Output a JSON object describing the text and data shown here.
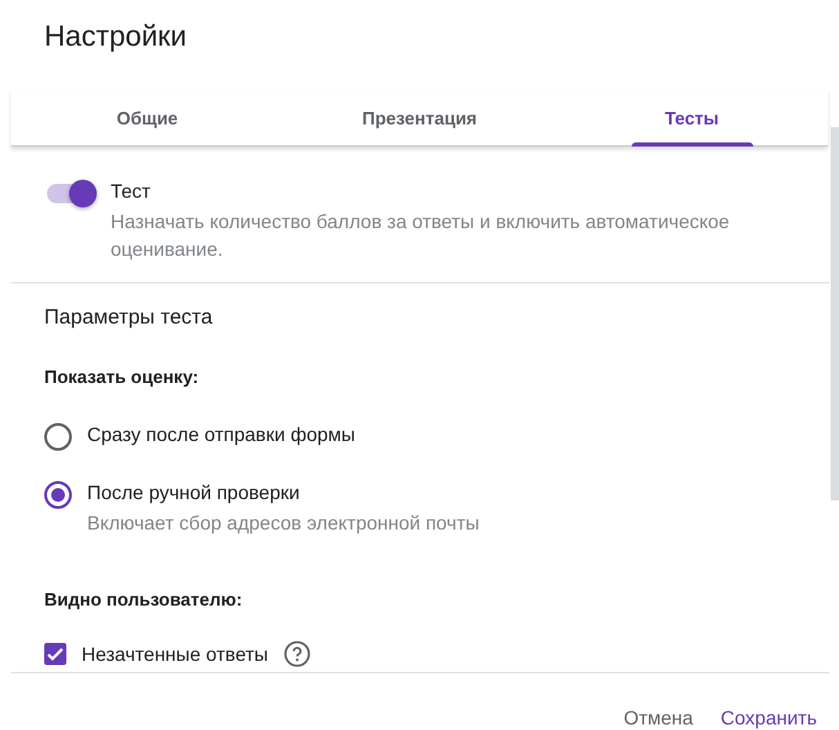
{
  "dialog": {
    "title": "Настройки"
  },
  "tabs": [
    {
      "label": "Общие",
      "selected": false
    },
    {
      "label": "Презентация",
      "selected": false
    },
    {
      "label": "Тесты",
      "selected": true
    }
  ],
  "quiz_toggle": {
    "label": "Тест",
    "description": "Назначать количество баллов за ответы и включить автоматическое оценивание.",
    "on": true
  },
  "section_title": "Параметры теста",
  "release_grade": {
    "heading": "Показать оценку:",
    "options": [
      {
        "label": "Сразу после отправки формы",
        "selected": false
      },
      {
        "label": "После ручной проверки",
        "hint": "Включает сбор адресов электронной почты",
        "selected": true
      }
    ]
  },
  "respondent_can_see": {
    "heading": "Видно пользователю:",
    "items": [
      {
        "label": "Незачтенные ответы",
        "checked": true,
        "help": true
      }
    ]
  },
  "buttons": [
    {
      "label": "Отмена",
      "kind": "cancel"
    },
    {
      "label": "Сохранить",
      "kind": "save"
    }
  ]
}
